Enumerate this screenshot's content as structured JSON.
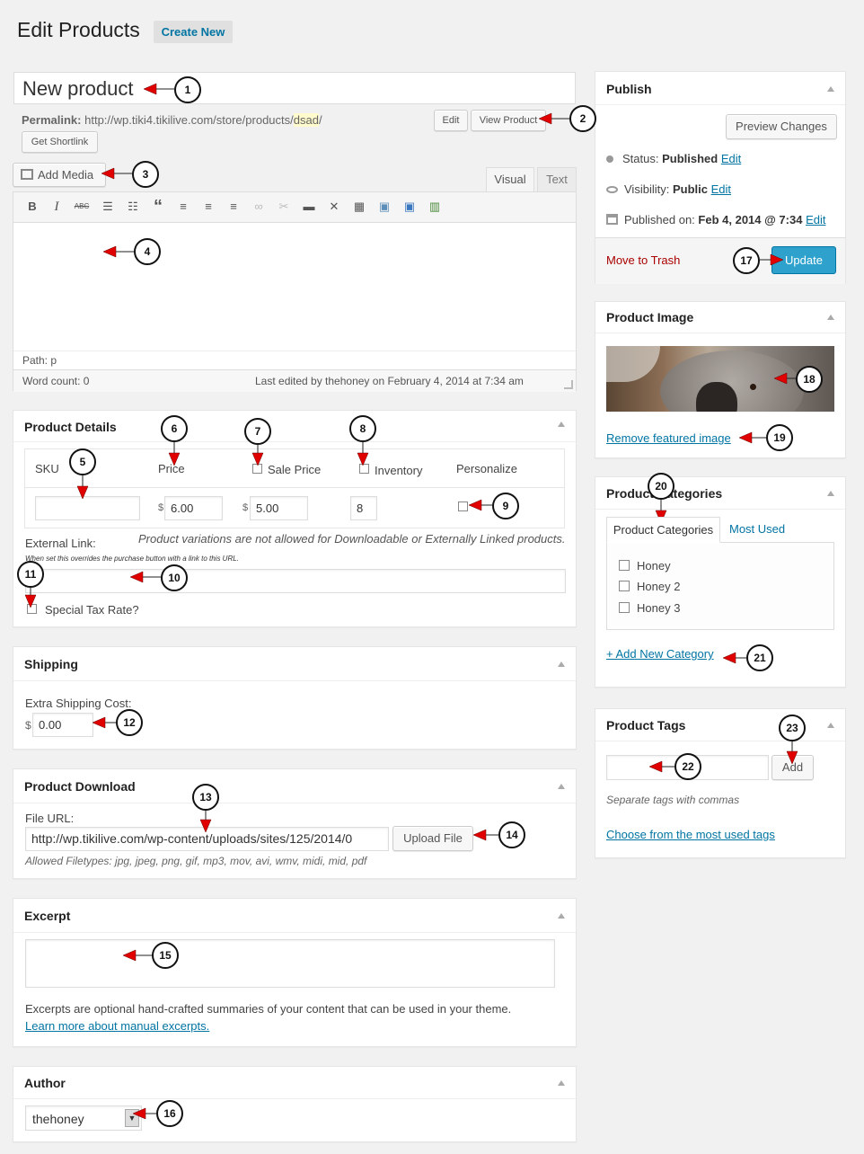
{
  "page": {
    "title": "Edit Products",
    "create_new": "Create New"
  },
  "post": {
    "title": "New product",
    "permalink_label": "Permalink:",
    "permalink_base": "http://wp.tiki4.tikilive.com/store/products/",
    "permalink_slug": "dsad",
    "permalink_trail": "/",
    "edit_btn": "Edit",
    "view_btn": "View Product",
    "shortlink_btn": "Get Shortlink",
    "add_media": "Add Media",
    "tab_visual": "Visual",
    "tab_text": "Text",
    "path_label": "Path: p",
    "word_count": "Word count: 0",
    "last_edited": "Last edited by thehoney on February 4, 2014 at 7:34 am"
  },
  "details": {
    "title": "Product Details",
    "col_sku": "SKU",
    "col_price": "Price",
    "col_sale": "Sale Price",
    "col_inventory": "Inventory",
    "col_personalize": "Personalize",
    "currency": "$",
    "price": "6.00",
    "sale_price": "5.00",
    "inventory": "8",
    "external_label": "External Link:",
    "variation_note": "Product variations are not allowed for Downloadable or Externally Linked products.",
    "external_hint": "When set this overrides the purchase button with a link to this URL.",
    "special_tax": "Special Tax Rate?"
  },
  "shipping": {
    "title": "Shipping",
    "label": "Extra Shipping Cost:",
    "currency": "$",
    "value": "0.00"
  },
  "download": {
    "title": "Product Download",
    "label": "File URL:",
    "value": "http://wp.tikilive.com/wp-content/uploads/sites/125/2014/0",
    "upload_btn": "Upload File",
    "filetypes": "Allowed Filetypes: jpg, jpeg, png, gif, mp3, mov, avi, wmv, midi, mid, pdf"
  },
  "excerpt": {
    "title": "Excerpt",
    "help": "Excerpts are optional hand-crafted summaries of your content that can be used in your theme.",
    "learn_more": "Learn more about manual excerpts."
  },
  "author": {
    "title": "Author",
    "value": "thehoney"
  },
  "publish": {
    "title": "Publish",
    "preview_btn": "Preview Changes",
    "status_label": "Status:",
    "status_value": "Published",
    "visibility_label": "Visibility:",
    "visibility_value": "Public",
    "published_label": "Published on:",
    "published_value": "Feb 4, 2014 @ 7:34",
    "edit_link": "Edit",
    "trash": "Move to Trash",
    "update_btn": "Update"
  },
  "image": {
    "title": "Product Image",
    "remove": "Remove featured image"
  },
  "categories": {
    "title": "Product Categories",
    "tab_all": "Product Categories",
    "tab_used": "Most Used",
    "items": [
      "Honey",
      "Honey 2",
      "Honey 3"
    ],
    "add_new": "+ Add New Category"
  },
  "tags": {
    "title": "Product Tags",
    "add_btn": "Add",
    "hint": "Separate tags with commas",
    "choose": "Choose from the most used tags"
  },
  "callouts": [
    "1",
    "2",
    "3",
    "4",
    "5",
    "6",
    "7",
    "8",
    "9",
    "10",
    "11",
    "12",
    "13",
    "14",
    "15",
    "16",
    "17",
    "18",
    "19",
    "20",
    "21",
    "22",
    "23"
  ],
  "colors": {
    "accent": "#2ea2cc",
    "link": "#0074a2",
    "trash": "#a00",
    "arrow": "#e00000"
  },
  "toolbar_icons": [
    "bold-icon",
    "italic-icon",
    "strikethrough-icon",
    "bullet-list-icon",
    "numbered-list-icon",
    "blockquote-icon",
    "align-left-icon",
    "align-center-icon",
    "align-right-icon",
    "link-icon",
    "unlink-icon",
    "more-tag-icon",
    "fullscreen-icon",
    "toolbar-toggle-icon",
    "gallery-icon",
    "insert-product-icon",
    "video-icon"
  ]
}
